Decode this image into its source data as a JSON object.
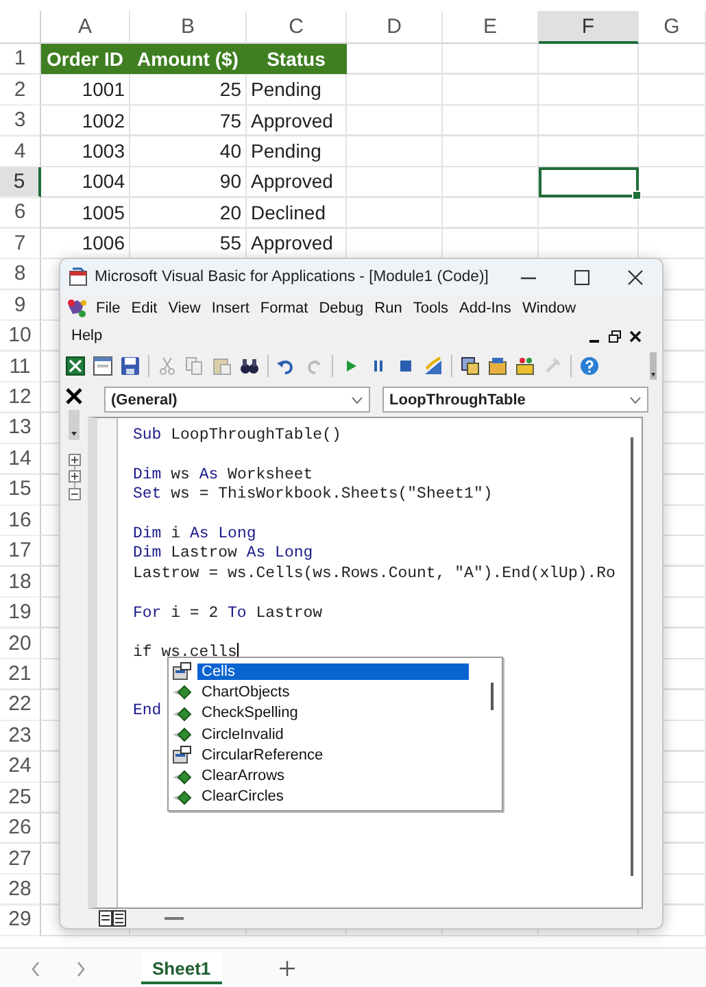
{
  "sheet": {
    "columns": [
      {
        "label": "A",
        "selected": false
      },
      {
        "label": "B",
        "selected": false
      },
      {
        "label": "C",
        "selected": false
      },
      {
        "label": "D",
        "selected": false
      },
      {
        "label": "E",
        "selected": false
      },
      {
        "label": "F",
        "selected": true
      },
      {
        "label": "G",
        "selected": false
      }
    ],
    "rows": [
      {
        "label": "1",
        "selected": false
      },
      {
        "label": "2",
        "selected": false
      },
      {
        "label": "3",
        "selected": false
      },
      {
        "label": "4",
        "selected": false
      },
      {
        "label": "5",
        "selected": true
      },
      {
        "label": "6",
        "selected": false
      },
      {
        "label": "7",
        "selected": false
      },
      {
        "label": "8",
        "selected": false
      },
      {
        "label": "9",
        "selected": false
      },
      {
        "label": "10",
        "selected": false
      },
      {
        "label": "11",
        "selected": false
      },
      {
        "label": "12",
        "selected": false
      },
      {
        "label": "13",
        "selected": false
      },
      {
        "label": "14",
        "selected": false
      },
      {
        "label": "15",
        "selected": false
      },
      {
        "label": "16",
        "selected": false
      },
      {
        "label": "17",
        "selected": false
      },
      {
        "label": "18",
        "selected": false
      },
      {
        "label": "19",
        "selected": false
      },
      {
        "label": "20",
        "selected": false
      },
      {
        "label": "21",
        "selected": false
      },
      {
        "label": "22",
        "selected": false
      },
      {
        "label": "23",
        "selected": false
      },
      {
        "label": "24",
        "selected": false
      },
      {
        "label": "25",
        "selected": false
      },
      {
        "label": "26",
        "selected": false
      },
      {
        "label": "27",
        "selected": false
      },
      {
        "label": "28",
        "selected": false
      },
      {
        "label": "29",
        "selected": false
      }
    ],
    "table": {
      "columns": [
        "Order ID",
        "Amount ($)",
        "Status"
      ],
      "rows": [
        [
          "1001",
          "25",
          "Pending"
        ],
        [
          "1002",
          "75",
          "Approved"
        ],
        [
          "1003",
          "40",
          "Pending"
        ],
        [
          "1004",
          "90",
          "Approved"
        ],
        [
          "1005",
          "20",
          "Declined"
        ],
        [
          "1006",
          "55",
          "Approved"
        ]
      ]
    },
    "sheet_tabs": [
      {
        "label": "Sheet1",
        "selected": true
      }
    ]
  },
  "vba_window": {
    "title": "Microsoft Visual Basic for Applications - [Module1 (Code)]",
    "menu": [
      "File",
      "Edit",
      "View",
      "Insert",
      "Format",
      "Debug",
      "Run",
      "Tools",
      "Add-Ins",
      "Window",
      "Help"
    ],
    "object_dropdown": "(General)",
    "procedure_dropdown": "LoopThroughTable",
    "code": [
      {
        "kind": "code",
        "segments": [
          {
            "text": "Sub",
            "keyword": true
          },
          {
            "text": " LoopThroughTable()",
            "keyword": false
          }
        ]
      },
      {
        "kind": "blank"
      },
      {
        "kind": "code",
        "segments": [
          {
            "text": "Dim",
            "keyword": true
          },
          {
            "text": " ws ",
            "keyword": false
          },
          {
            "text": "As",
            "keyword": true
          },
          {
            "text": " Worksheet",
            "keyword": false
          }
        ]
      },
      {
        "kind": "code",
        "segments": [
          {
            "text": "Set",
            "keyword": true
          },
          {
            "text": " ws = ThisWorkbook.Sheets(\"Sheet1\")",
            "keyword": false
          }
        ]
      },
      {
        "kind": "blank"
      },
      {
        "kind": "code",
        "segments": [
          {
            "text": "Dim",
            "keyword": true
          },
          {
            "text": " i ",
            "keyword": false
          },
          {
            "text": "As Long",
            "keyword": true
          }
        ]
      },
      {
        "kind": "code",
        "segments": [
          {
            "text": "Dim",
            "keyword": true
          },
          {
            "text": " Lastrow ",
            "keyword": false
          },
          {
            "text": "As Long",
            "keyword": true
          }
        ]
      },
      {
        "kind": "code",
        "segments": [
          {
            "text": "Lastrow = ws.Cells(ws.Rows.Count, \"A\").End(xlUp).Ro",
            "keyword": false
          }
        ]
      },
      {
        "kind": "blank"
      },
      {
        "kind": "code",
        "segments": [
          {
            "text": "For",
            "keyword": true
          },
          {
            "text": " i = 2 ",
            "keyword": false
          },
          {
            "text": "To",
            "keyword": true
          },
          {
            "text": " Lastrow",
            "keyword": false
          }
        ]
      },
      {
        "kind": "blank"
      },
      {
        "kind": "code",
        "segments": [
          {
            "text": "if ws.cells",
            "keyword": false
          }
        ]
      },
      {
        "kind": "blank"
      },
      {
        "kind": "blank"
      },
      {
        "kind": "code",
        "segments": [
          {
            "text": "End",
            "keyword": true
          }
        ]
      }
    ],
    "autocomplete": [
      {
        "label": "Cells",
        "kind": "property",
        "selected": true
      },
      {
        "label": "ChartObjects",
        "kind": "method",
        "selected": false
      },
      {
        "label": "CheckSpelling",
        "kind": "method",
        "selected": false
      },
      {
        "label": "CircleInvalid",
        "kind": "method",
        "selected": false
      },
      {
        "label": "CircularReference",
        "kind": "property",
        "selected": false
      },
      {
        "label": "ClearArrows",
        "kind": "method",
        "selected": false
      },
      {
        "label": "ClearCircles",
        "kind": "method",
        "selected": false
      }
    ]
  }
}
